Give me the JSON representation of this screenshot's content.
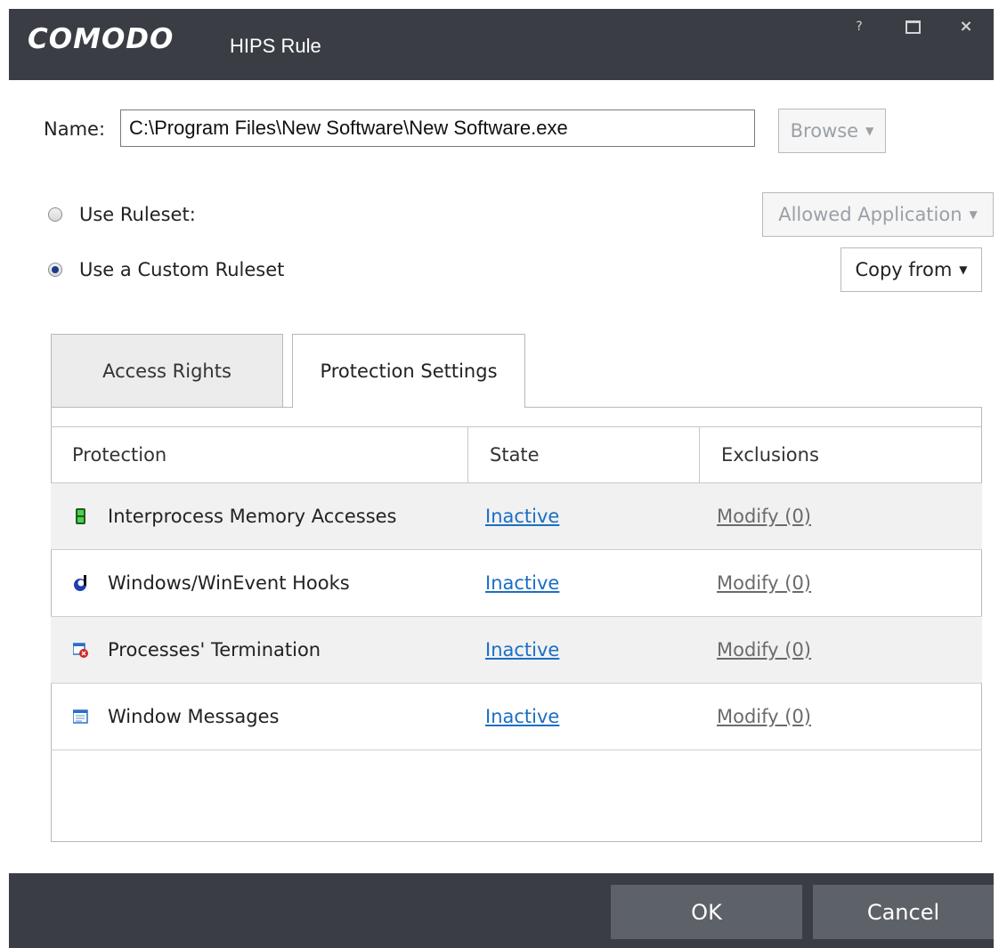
{
  "window": {
    "logo": "COMODO",
    "title": "HIPS Rule",
    "help_label": "?",
    "close_label": "×"
  },
  "name": {
    "label": "Name:",
    "value": "C:\\Program Files\\New Software\\New Software.exe",
    "browse_label": "Browse"
  },
  "ruleset": {
    "use_ruleset_label": "Use Ruleset:",
    "use_ruleset_selected": false,
    "ruleset_dropdown": "Allowed Application",
    "use_custom_label": "Use a Custom Ruleset",
    "use_custom_selected": true,
    "copy_from_label": "Copy from"
  },
  "tabs": [
    {
      "label": "Access Rights",
      "active": false
    },
    {
      "label": "Protection Settings",
      "active": true
    }
  ],
  "table": {
    "headers": [
      "Protection",
      "State",
      "Exclusions"
    ],
    "rows": [
      {
        "icon": "memory-chip-icon",
        "protection": "Interprocess Memory Accesses",
        "state": "Inactive",
        "exclusions": "Modify (0)"
      },
      {
        "icon": "hook-icon",
        "protection": "Windows/WinEvent Hooks",
        "state": "Inactive",
        "exclusions": "Modify (0)"
      },
      {
        "icon": "terminate-process-icon",
        "protection": "Processes' Termination",
        "state": "Inactive",
        "exclusions": "Modify (0)"
      },
      {
        "icon": "window-messages-icon",
        "protection": "Window Messages",
        "state": "Inactive",
        "exclusions": "Modify (0)"
      }
    ]
  },
  "footer": {
    "ok_label": "OK",
    "cancel_label": "Cancel"
  },
  "colors": {
    "titlebar": "#3a3e44",
    "footer_button": "#5d6168",
    "link": "#1a6fc4"
  }
}
